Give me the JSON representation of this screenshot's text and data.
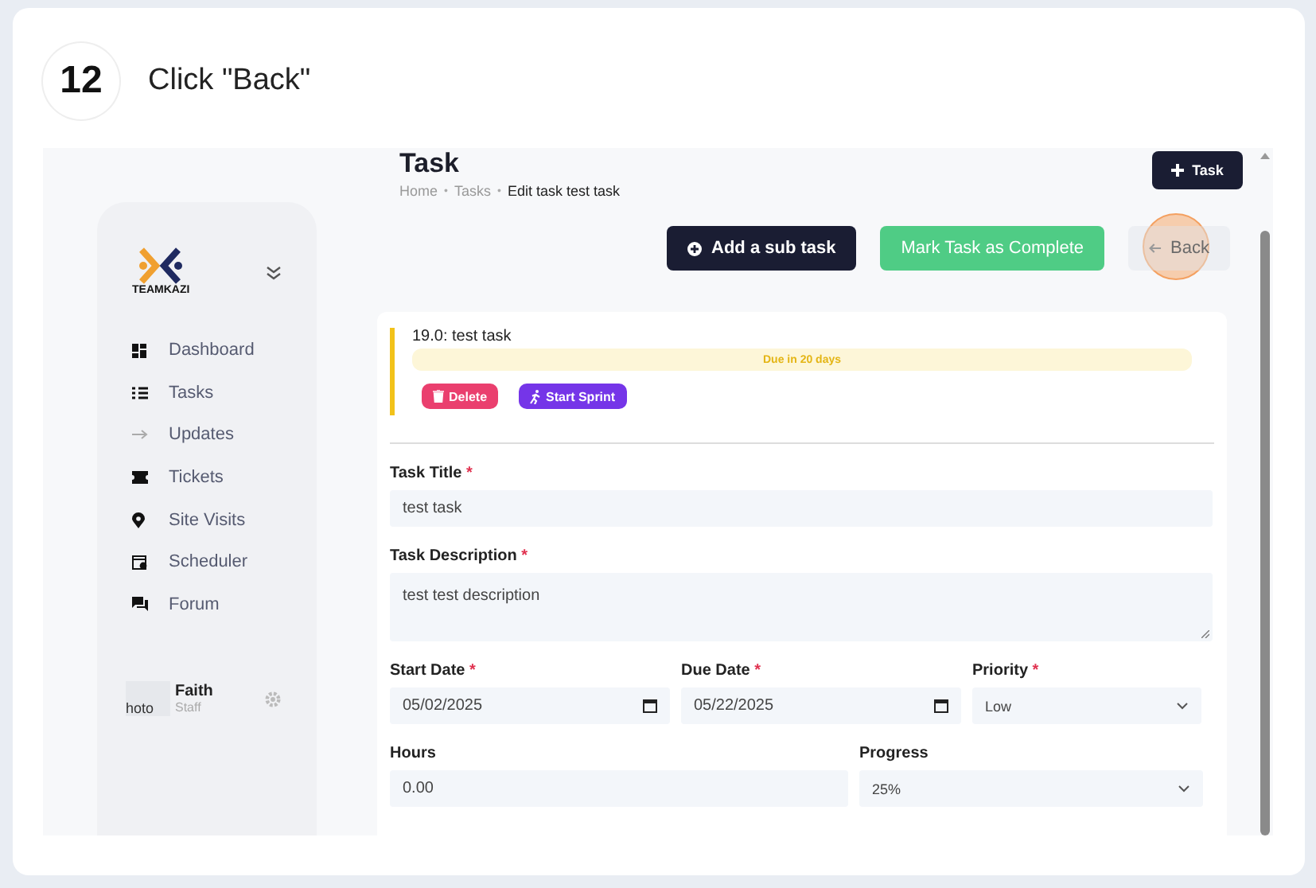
{
  "step": {
    "number": "12",
    "instruction": "Click \"Back\""
  },
  "sidebar": {
    "logo_text": "TEAMKAZI",
    "nav_items": [
      {
        "label": "Dashboard"
      },
      {
        "label": "Tasks"
      },
      {
        "label": "Updates"
      },
      {
        "label": "Tickets"
      },
      {
        "label": "Site Visits"
      },
      {
        "label": "Scheduler"
      },
      {
        "label": "Forum"
      }
    ],
    "user": {
      "photo_alt": "hoto",
      "name": "Faith",
      "role": "Staff"
    }
  },
  "header": {
    "title": "Task",
    "breadcrumbs": [
      "Home",
      "Tasks",
      "Edit task test task"
    ],
    "breadcrumb_separator": "•",
    "new_button": "Task"
  },
  "actions": [
    {
      "label": "Add a sub task",
      "kind": "dark",
      "highlighted": false
    },
    {
      "label": "Mark Task as Complete",
      "kind": "success",
      "highlighted": false
    },
    {
      "label": "Back",
      "kind": "back",
      "highlighted": true
    }
  ],
  "task": {
    "heading": "19.0: test task",
    "due_badge": "Due in 20 days",
    "buttons": [
      {
        "label": "Delete",
        "kind": "delete"
      },
      {
        "label": "Start Sprint",
        "kind": "sprint"
      }
    ]
  },
  "required_mark": "*",
  "form_rows": [
    [
      {
        "label": "Task Title",
        "required": true,
        "kind": "text",
        "value": "test task"
      }
    ],
    [
      {
        "label": "Task Description",
        "required": true,
        "kind": "textarea",
        "value": "test test description"
      }
    ],
    [
      {
        "label": "Start Date",
        "required": true,
        "kind": "date",
        "value": "05/02/2025"
      },
      {
        "label": "Due Date",
        "required": true,
        "kind": "date",
        "value": "05/22/2025"
      },
      {
        "label": "Priority",
        "required": true,
        "kind": "select",
        "value": "Low"
      }
    ],
    [
      {
        "label": "Hours",
        "required": false,
        "kind": "text",
        "value": "0.00"
      },
      {
        "label": "Progress",
        "required": false,
        "kind": "select",
        "value": "25%"
      }
    ]
  ]
}
